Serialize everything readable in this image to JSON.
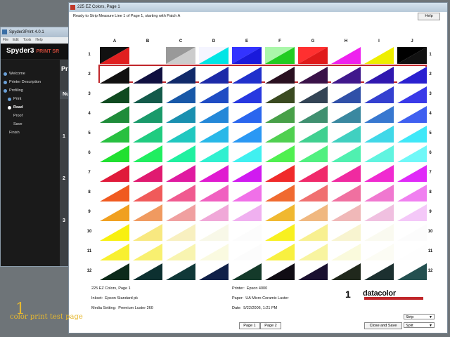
{
  "spyder": {
    "title": "Spyder3Print 4.0.1",
    "menu": [
      "File",
      "Edit",
      "Tools",
      "Help"
    ],
    "logo_main": "Spyder3",
    "logo_sub": "PRINT SR",
    "panel_heading": "Profi",
    "panel_num_header": "Num",
    "steps": [
      {
        "label": "Welcome",
        "state": "done"
      },
      {
        "label": "Printer Description",
        "state": "done"
      },
      {
        "label": "Profiling",
        "state": "done"
      },
      {
        "label": "Print",
        "state": "done"
      },
      {
        "label": "Read",
        "state": "current"
      },
      {
        "label": "Proof",
        "state": "pending"
      },
      {
        "label": "Save",
        "state": "pending"
      },
      {
        "label": "Finish",
        "state": "pending"
      }
    ],
    "panel_numbers": [
      "1",
      "2",
      "3"
    ]
  },
  "ez": {
    "title": "225 EZ Colors, Page 1",
    "status": "Ready to Strip Measure Line 1 of Page 1, starting with Patch A",
    "help_label": "Help",
    "columns": [
      "A",
      "B",
      "C",
      "D",
      "E",
      "F",
      "G",
      "H",
      "I",
      "J"
    ],
    "rows": [
      "1",
      "2",
      "3",
      "4",
      "5",
      "6",
      "7",
      "8",
      "9",
      "10",
      "11",
      "12"
    ],
    "highlight_row": "1",
    "patches": [
      [
        [
          "#e02020",
          "#111111"
        ],
        [
          "#ffffff",
          "#ffffff"
        ],
        [
          "#cccccc",
          "#999999"
        ],
        [
          "#00e5e5",
          "#f5f5ff"
        ],
        [
          "#1a1adc",
          "#3333ff"
        ],
        [
          "#22cc22",
          "#aaf7aa"
        ],
        [
          "#e01a1a",
          "#ff3030"
        ],
        [
          "#ee22ee",
          "#ffffff"
        ],
        [
          "#eeee00",
          "#ffffff"
        ],
        [
          "#111111",
          "#000000"
        ]
      ],
      [
        [
          "#111111",
          "#ffffff"
        ],
        [
          "#101040",
          "#ffffff"
        ],
        [
          "#112a6a",
          "#ffffff"
        ],
        [
          "#1c2aa8",
          "#ffffff"
        ],
        [
          "#2030cc",
          "#ffffff"
        ],
        [
          "#2a1020",
          "#ffffff"
        ],
        [
          "#3a1248",
          "#ffffff"
        ],
        [
          "#40188c",
          "#ffffff"
        ],
        [
          "#3018b0",
          "#ffffff"
        ],
        [
          "#2a20d0",
          "#ffffff"
        ]
      ],
      [
        [
          "#0f4a20",
          "#ffffff"
        ],
        [
          "#135a4a",
          "#ffffff"
        ],
        [
          "#1858a8",
          "#ffffff"
        ],
        [
          "#1f4cc4",
          "#ffffff"
        ],
        [
          "#2738e0",
          "#ffffff"
        ],
        [
          "#3a4a20",
          "#ffffff"
        ],
        [
          "#334455",
          "#ffffff"
        ],
        [
          "#3050a8",
          "#ffffff"
        ],
        [
          "#3440d0",
          "#ffffff"
        ],
        [
          "#3a3ae8",
          "#ffffff"
        ]
      ],
      [
        [
          "#1f8c3a",
          "#ffffff"
        ],
        [
          "#1a9a6a",
          "#ffffff"
        ],
        [
          "#1a90b0",
          "#ffffff"
        ],
        [
          "#2488d8",
          "#ffffff"
        ],
        [
          "#2a66ee",
          "#ffffff"
        ],
        [
          "#48a048",
          "#ffffff"
        ],
        [
          "#409070",
          "#ffffff"
        ],
        [
          "#3a88a0",
          "#ffffff"
        ],
        [
          "#3878d0",
          "#ffffff"
        ],
        [
          "#4060f0",
          "#ffffff"
        ]
      ],
      [
        [
          "#28c040",
          "#ffffff"
        ],
        [
          "#20cc80",
          "#ffffff"
        ],
        [
          "#20c8c0",
          "#ffffff"
        ],
        [
          "#28b8e8",
          "#ffffff"
        ],
        [
          "#2a98f4",
          "#ffffff"
        ],
        [
          "#50d050",
          "#ffffff"
        ],
        [
          "#40d090",
          "#ffffff"
        ],
        [
          "#40d0c0",
          "#ffffff"
        ],
        [
          "#40d8e8",
          "#ffffff"
        ],
        [
          "#40e8f8",
          "#ffffff"
        ]
      ],
      [
        [
          "#20e030",
          "#ffffff"
        ],
        [
          "#20ee60",
          "#ffffff"
        ],
        [
          "#20f0a0",
          "#ffffff"
        ],
        [
          "#30f0d0",
          "#ffffff"
        ],
        [
          "#40f0f0",
          "#ffffff"
        ],
        [
          "#50f050",
          "#ffffff"
        ],
        [
          "#50f080",
          "#ffffff"
        ],
        [
          "#50f0b0",
          "#ffffff"
        ],
        [
          "#60f4e0",
          "#ffffff"
        ],
        [
          "#70f8f8",
          "#ffffff"
        ]
      ],
      [
        [
          "#e01a3a",
          "#ffffff"
        ],
        [
          "#e01a70",
          "#ffffff"
        ],
        [
          "#e01aa0",
          "#ffffff"
        ],
        [
          "#e01ad0",
          "#ffffff"
        ],
        [
          "#d01af0",
          "#ffffff"
        ],
        [
          "#f02a2a",
          "#ffffff"
        ],
        [
          "#f02a6a",
          "#ffffff"
        ],
        [
          "#f02aa0",
          "#ffffff"
        ],
        [
          "#f02ad0",
          "#ffffff"
        ],
        [
          "#e02af8",
          "#ffffff"
        ]
      ],
      [
        [
          "#f05a20",
          "#ffffff"
        ],
        [
          "#f05a5a",
          "#ffffff"
        ],
        [
          "#f05a90",
          "#ffffff"
        ],
        [
          "#f060c0",
          "#ffffff"
        ],
        [
          "#f070e8",
          "#ffffff"
        ],
        [
          "#f06a30",
          "#ffffff"
        ],
        [
          "#f07070",
          "#ffffff"
        ],
        [
          "#f070a0",
          "#ffffff"
        ],
        [
          "#f078d0",
          "#ffffff"
        ],
        [
          "#f080f0",
          "#ffffff"
        ]
      ],
      [
        [
          "#f0a020",
          "#ffffff"
        ],
        [
          "#f09a60",
          "#ffffff"
        ],
        [
          "#f0a0a0",
          "#ffffff"
        ],
        [
          "#f0a8d8",
          "#ffffff"
        ],
        [
          "#f0b0f0",
          "#ffffff"
        ],
        [
          "#f0b830",
          "#ffffff"
        ],
        [
          "#f0b880",
          "#ffffff"
        ],
        [
          "#f0b8b8",
          "#ffffff"
        ],
        [
          "#f0c0e0",
          "#ffffff"
        ],
        [
          "#f4c8f8",
          "#ffffff"
        ]
      ],
      [
        [
          "#f8f010",
          "#ffffff"
        ],
        [
          "#f8e880",
          "#ffffff"
        ],
        [
          "#f8f0c0",
          "#ffffff"
        ],
        [
          "#f8f8e8",
          "#ffffff"
        ],
        [
          "#fcfcfc",
          "#ffffff"
        ],
        [
          "#f8f020",
          "#ffffff"
        ],
        [
          "#f8f090",
          "#ffffff"
        ],
        [
          "#f8f4d0",
          "#ffffff"
        ],
        [
          "#fafaf0",
          "#ffffff"
        ],
        [
          "#fcfcfc",
          "#ffffff"
        ]
      ],
      [
        [
          "#f8f030",
          "#ffffff"
        ],
        [
          "#f8f070",
          "#ffffff"
        ],
        [
          "#f8f4b0",
          "#ffffff"
        ],
        [
          "#fafae0",
          "#ffffff"
        ],
        [
          "#fcfcfc",
          "#ffffff"
        ],
        [
          "#f8f040",
          "#ffffff"
        ],
        [
          "#f8f4a0",
          "#ffffff"
        ],
        [
          "#fafadc",
          "#ffffff"
        ],
        [
          "#fcfcf4",
          "#ffffff"
        ],
        [
          "#fefefe",
          "#ffffff"
        ]
      ],
      [
        [
          "#0c2a1a",
          "#ffffff"
        ],
        [
          "#0c3030",
          "#ffffff"
        ],
        [
          "#103838",
          "#ffffff"
        ],
        [
          "#102048",
          "#ffffff"
        ],
        [
          "#143a2a",
          "#ffffff"
        ],
        [
          "#100c14",
          "#ffffff"
        ],
        [
          "#1a1030",
          "#ffffff"
        ],
        [
          "#20281c",
          "#ffffff"
        ],
        [
          "#1c3030",
          "#ffffff"
        ],
        [
          "#245050",
          "#ffffff"
        ]
      ]
    ],
    "info": {
      "chart_name": "225 EZ Colors, Page 1",
      "inkset_label": "Inkset:",
      "inkset_value": "Epson Standard pk",
      "media_label": "Media Setting:",
      "media_value": "Premium Luster 260",
      "printer_label": "Printer:",
      "printer_value": "Epson 4000",
      "paper_label": "Paper:",
      "paper_value": "UA Micro Ceramic Luster",
      "date_label": "Date:",
      "date_value": "5/22/2006, 1:21 PM",
      "page_number": "1",
      "brand": "datacolor"
    },
    "page_tabs": [
      "Page 1",
      "Page 2"
    ],
    "close_save_label": "Close and Save",
    "mode_select": "Strip",
    "split_select": "Split"
  },
  "watermark": {
    "number": "1",
    "text": "color print test page"
  }
}
